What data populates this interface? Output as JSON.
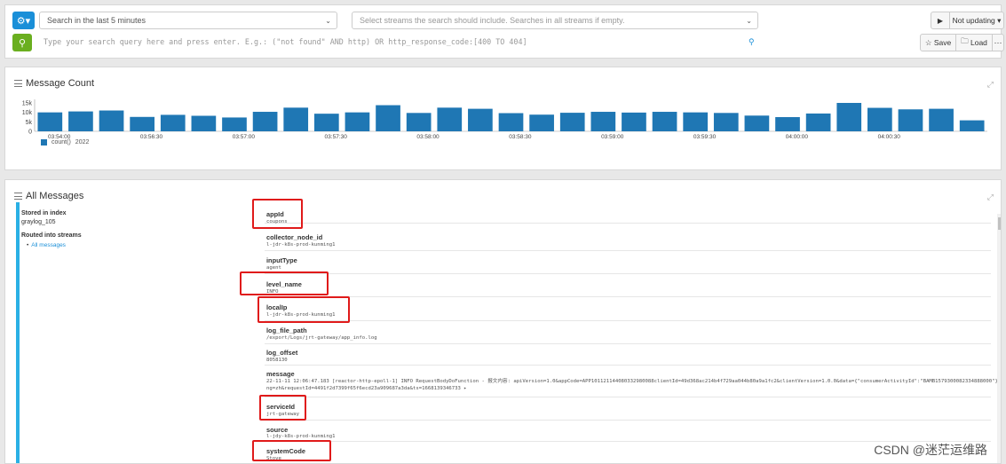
{
  "search": {
    "range_label": "Search in the last 5 minutes",
    "streams_placeholder": "Select streams the search should include. Searches in all streams if empty.",
    "query_placeholder": "Type your search query here and press enter. E.g.: (\"not found\" AND http) OR http_response_code:[400 TO 404]",
    "updating_label": "Not updating",
    "save_label": "Save",
    "load_label": "Load",
    "more_label": "···",
    "play_icon": "▶",
    "bulb_icon": "💡"
  },
  "count_panel": {
    "title": "Message Count"
  },
  "chart_data": {
    "type": "bar",
    "title": "",
    "y_ticks": [
      "15k",
      "10k",
      "5k",
      "0"
    ],
    "ylim": [
      0,
      15000
    ],
    "x_tick_labels": [
      "03:54:00",
      "03:56:30",
      "03:57:00",
      "03:57:30",
      "03:58:00",
      "03:58:30",
      "03:59:00",
      "03:59:30",
      "04:00:00",
      "04:00:30"
    ],
    "values": [
      10000,
      10500,
      11000,
      7600,
      8700,
      8200,
      7300,
      10300,
      12500,
      9300,
      10000,
      13800,
      9700,
      12500,
      11900,
      9600,
      8800,
      9800,
      10300,
      9900,
      10300,
      10000,
      9700,
      8300,
      7500,
      9400,
      17000,
      12400,
      11600,
      11900,
      5800
    ],
    "legend": {
      "label": "count()",
      "note": "2022"
    },
    "color": "#1f77b4"
  },
  "messages_panel": {
    "title": "All Messages",
    "stored_label": "Stored in index",
    "stored_value": "graylog_105",
    "routed_label": "Routed into streams",
    "stream": "All messages",
    "fields": [
      {
        "name": "appId",
        "value": "coupons"
      },
      {
        "name": "collector_node_id",
        "value": "l-jdr-k8s-prod-kunming1"
      },
      {
        "name": "inputType",
        "value": "agent"
      },
      {
        "name": "level_name",
        "value": "INFO"
      },
      {
        "name": "localIp",
        "value": "l-jdr-k8s-prod-kunming1"
      },
      {
        "name": "log_file_path",
        "value": "/export/Logs/jrt-gateway/app_info.log"
      },
      {
        "name": "log_offset",
        "value": "8058130"
      },
      {
        "name": "message",
        "value": "22-11-11 12:06:47.183 [reactor-http-epoll-1] INFO  RequestBodyDoFunction  - 报文内容: apiVersion=1.0&appCode=APP101121144080332980088clientId=49d368ac214b4f729aa044b80a9a1fc2&clientVersion=1.0.0&data={\"consumerActivityId\":\"BAMB1579300082334888000\"}&lang=zh&requestId=4491f2d7399f65f6ecd23a909687a3da&ts=1668139346733 ▸"
      },
      {
        "name": "serviceId",
        "value": "jrt-gateway"
      },
      {
        "name": "source",
        "value": "l-jdy-k8s-prod-kunming1"
      },
      {
        "name": "systemCode",
        "value": "Stove"
      }
    ],
    "watermark": "CSDN @迷茫运维路"
  }
}
